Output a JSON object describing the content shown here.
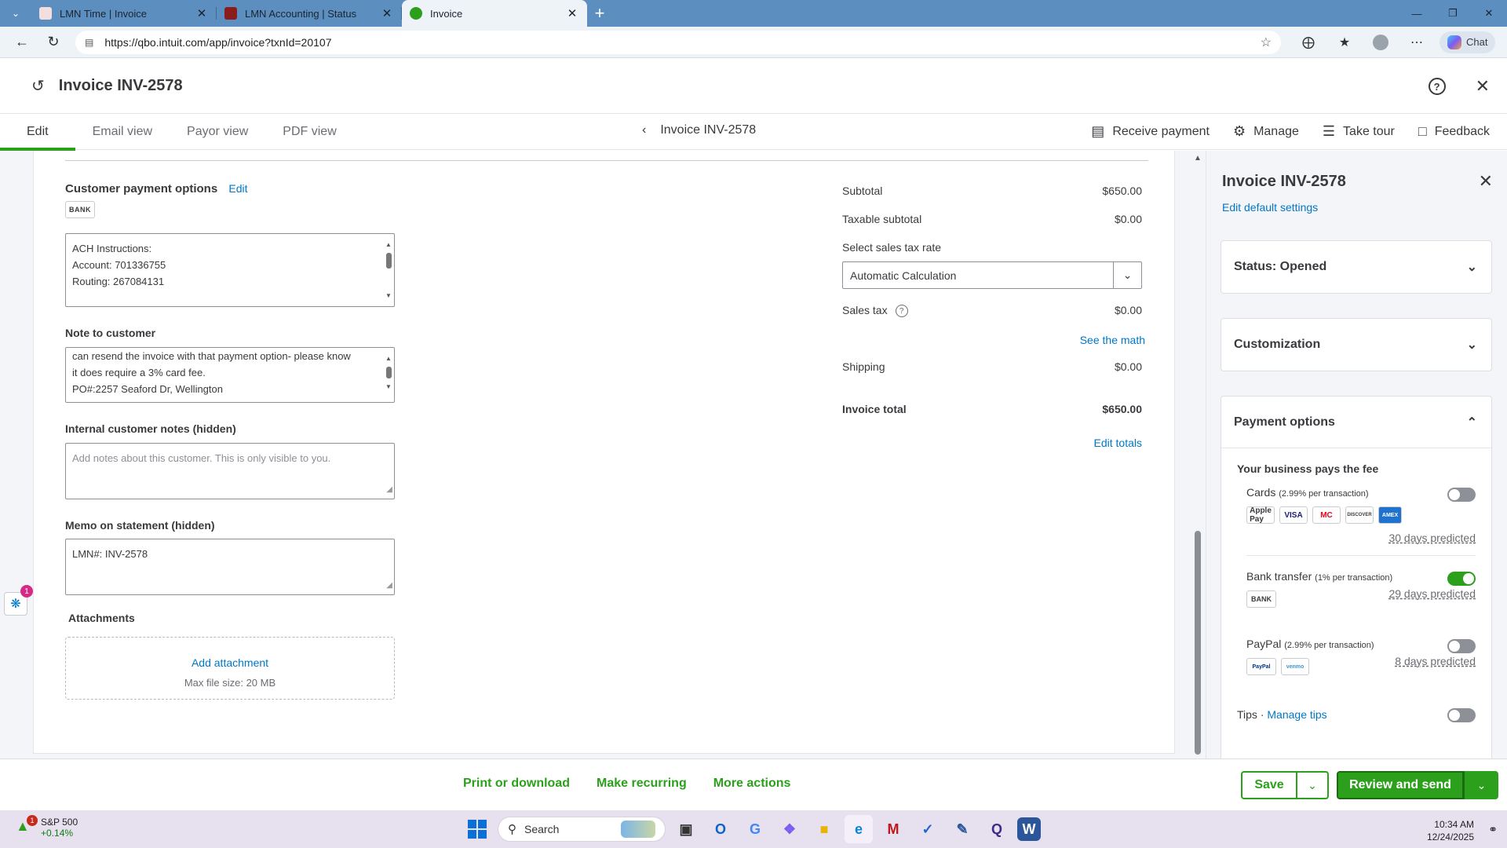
{
  "browser": {
    "tabs": [
      {
        "label": "LMN Time | Invoice",
        "color": "#e8e4e4",
        "active": false
      },
      {
        "label": "LMN Accounting | Status",
        "color": "#8a1c1c",
        "active": false
      },
      {
        "label": "Invoice",
        "color": "#2ca01c",
        "active": true
      }
    ],
    "url": "https://qbo.intuit.com/app/invoice?txnId=20107",
    "chat_label": "Chat"
  },
  "header": {
    "title": "Invoice INV-2578"
  },
  "toolbar": {
    "tabs": [
      "Edit",
      "Email view",
      "Payor view",
      "PDF view"
    ],
    "breadcrumb": "Invoice INV-2578",
    "actions": {
      "receive_payment": "Receive payment",
      "manage": "Manage",
      "take_tour": "Take tour",
      "feedback": "Feedback"
    }
  },
  "form": {
    "payment_options_label": "Customer payment options",
    "edit_link": "Edit",
    "bank_badge": "BANK",
    "ach_lines": [
      "ACH Instructions:",
      "Account: 701336755",
      "Routing: 267084131"
    ],
    "note_label": "Note to customer",
    "note_lines": [
      "can resend the invoice with that payment option- please know",
      "it does require a 3% card fee.",
      "PO#:2257 Seaford Dr, Wellington"
    ],
    "internal_label": "Internal customer notes (hidden)",
    "internal_placeholder": "Add notes about this customer. This is only visible to you.",
    "memo_label": "Memo on statement (hidden)",
    "memo_value": "LMN#: INV-2578",
    "attachments_label": "Attachments",
    "add_attachment": "Add attachment",
    "max_file": "Max file size: 20 MB",
    "widget_count": "1"
  },
  "totals": {
    "subtotal_label": "Subtotal",
    "subtotal": "$650.00",
    "taxable_label": "Taxable subtotal",
    "taxable": "$0.00",
    "tax_rate_label": "Select sales tax rate",
    "tax_rate_value": "Automatic Calculation",
    "sales_tax_label": "Sales tax",
    "sales_tax": "$0.00",
    "see_math": "See the math",
    "shipping_label": "Shipping",
    "shipping": "$0.00",
    "total_label": "Invoice total",
    "total": "$650.00",
    "edit_totals": "Edit totals"
  },
  "drawer": {
    "title": "Invoice INV-2578",
    "edit_defaults": "Edit default settings",
    "status": "Status: Opened",
    "customization": "Customization",
    "payment_options": "Payment options",
    "fee_note": "Your business pays the fee",
    "cards_label": "Cards",
    "cards_fee": "(2.99% per transaction)",
    "card_logos": [
      "Apple Pay",
      "VISA",
      "MC",
      "DISCOVER",
      "AMEX"
    ],
    "cards_predicted": "30 days predicted",
    "bank_label": "Bank transfer",
    "bank_fee": "(1% per transaction)",
    "bank_badge": "BANK",
    "bank_predicted": "29 days predicted",
    "paypal_label": "PayPal",
    "paypal_fee": "(2.99% per transaction)",
    "paypal_logos": [
      "PayPal",
      "venmo"
    ],
    "paypal_predicted": "8 days predicted",
    "tips_label": "Tips",
    "tips_sep": "·",
    "manage_tips": "Manage tips"
  },
  "footer": {
    "print": "Print or download",
    "recurring": "Make recurring",
    "more": "More actions",
    "save": "Save",
    "review": "Review and send"
  },
  "taskbar": {
    "stock_name": "S&P 500",
    "stock_change": "+0.14%",
    "stock_badge": "1",
    "search": "Search",
    "time": "10:34 AM",
    "date": "12/24/2025"
  }
}
